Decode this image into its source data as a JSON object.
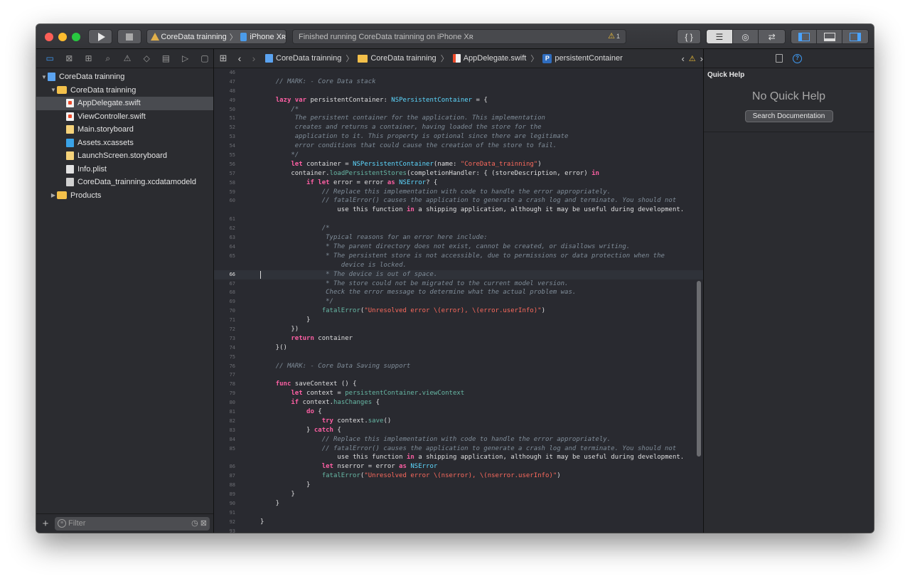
{
  "toolbar": {
    "scheme_app": "CoreData trainning",
    "scheme_device": "iPhone Xʀ",
    "activity_text": "Finished running CoreData trainning on iPhone Xʀ",
    "warning_count": "1",
    "braces_label": "{ }"
  },
  "navigator": {
    "items": [
      {
        "label": "CoreData trainning",
        "icon": "project-icon",
        "depth": 0,
        "disclosure": "open"
      },
      {
        "label": "CoreData trainning",
        "icon": "folder-icon",
        "depth": 1,
        "disclosure": "open"
      },
      {
        "label": "AppDelegate.swift",
        "icon": "swift-file-icon",
        "depth": 2,
        "selected": true
      },
      {
        "label": "ViewController.swift",
        "icon": "swift-file-icon",
        "depth": 2
      },
      {
        "label": "Main.storyboard",
        "icon": "storyboard-icon",
        "depth": 2
      },
      {
        "label": "Assets.xcassets",
        "icon": "assets-icon",
        "depth": 2
      },
      {
        "label": "LaunchScreen.storyboard",
        "icon": "storyboard-icon",
        "depth": 2
      },
      {
        "label": "Info.plist",
        "icon": "plist-icon",
        "depth": 2
      },
      {
        "label": "CoreData_trainning.xcdatamodeld",
        "icon": "datamodel-icon",
        "depth": 2
      },
      {
        "label": "Products",
        "icon": "folder-icon",
        "depth": 1,
        "disclosure": "closed"
      }
    ],
    "filter_placeholder": "Filter"
  },
  "jumpbar": {
    "crumbs": [
      "CoreData trainning",
      "CoreData trainning",
      "AppDelegate.swift",
      "persistentContainer"
    ],
    "prop_badge": "P"
  },
  "editor": {
    "current_line": 66,
    "lines": [
      {
        "n": "46",
        "text": ""
      },
      {
        "n": "47",
        "text": "    // MARK: - Core Data stack"
      },
      {
        "n": "48",
        "text": ""
      },
      {
        "n": "49",
        "text": "    lazy var persistentContainer: NSPersistentContainer = {"
      },
      {
        "n": "50",
        "text": "        /*"
      },
      {
        "n": "51",
        "text": "         The persistent container for the application. This implementation"
      },
      {
        "n": "52",
        "text": "         creates and returns a container, having loaded the store for the"
      },
      {
        "n": "53",
        "text": "         application to it. This property is optional since there are legitimate"
      },
      {
        "n": "54",
        "text": "         error conditions that could cause the creation of the store to fail."
      },
      {
        "n": "55",
        "text": "        */"
      },
      {
        "n": "56",
        "text": "        let container = NSPersistentContainer(name: \"CoreData_trainning\")"
      },
      {
        "n": "57",
        "text": "        container.loadPersistentStores(completionHandler: { (storeDescription, error) in"
      },
      {
        "n": "58",
        "text": "            if let error = error as NSError? {"
      },
      {
        "n": "59",
        "text": "                // Replace this implementation with code to handle the error appropriately."
      },
      {
        "n": "60",
        "text": "                // fatalError() causes the application to generate a crash log and terminate. You should not\n                    use this function in a shipping application, although it may be useful during development."
      },
      {
        "n": "61",
        "text": ""
      },
      {
        "n": "62",
        "text": "                /*"
      },
      {
        "n": "63",
        "text": "                 Typical reasons for an error here include:"
      },
      {
        "n": "64",
        "text": "                 * The parent directory does not exist, cannot be created, or disallows writing."
      },
      {
        "n": "65",
        "text": "                 * The persistent store is not accessible, due to permissions or data protection when the\n                     device is locked."
      },
      {
        "n": "66",
        "text": "                 * The device is out of space."
      },
      {
        "n": "67",
        "text": "                 * The store could not be migrated to the current model version."
      },
      {
        "n": "68",
        "text": "                 Check the error message to determine what the actual problem was."
      },
      {
        "n": "69",
        "text": "                 */"
      },
      {
        "n": "70",
        "text": "                fatalError(\"Unresolved error \\(error), \\(error.userInfo)\")"
      },
      {
        "n": "71",
        "text": "            }"
      },
      {
        "n": "72",
        "text": "        })"
      },
      {
        "n": "73",
        "text": "        return container"
      },
      {
        "n": "74",
        "text": "    }()"
      },
      {
        "n": "75",
        "text": ""
      },
      {
        "n": "76",
        "text": "    // MARK: - Core Data Saving support"
      },
      {
        "n": "77",
        "text": ""
      },
      {
        "n": "78",
        "text": "    func saveContext () {"
      },
      {
        "n": "79",
        "text": "        let context = persistentContainer.viewContext"
      },
      {
        "n": "80",
        "text": "        if context.hasChanges {"
      },
      {
        "n": "81",
        "text": "            do {"
      },
      {
        "n": "82",
        "text": "                try context.save()"
      },
      {
        "n": "83",
        "text": "            } catch {"
      },
      {
        "n": "84",
        "text": "                // Replace this implementation with code to handle the error appropriately."
      },
      {
        "n": "85",
        "text": "                // fatalError() causes the application to generate a crash log and terminate. You should not\n                    use this function in a shipping application, although it may be useful during development."
      },
      {
        "n": "86",
        "text": "                let nserror = error as NSError"
      },
      {
        "n": "87",
        "text": "                fatalError(\"Unresolved error \\(nserror), \\(nserror.userInfo)\")"
      },
      {
        "n": "88",
        "text": "            }"
      },
      {
        "n": "89",
        "text": "        }"
      },
      {
        "n": "90",
        "text": "    }"
      },
      {
        "n": "91",
        "text": ""
      },
      {
        "n": "92",
        "text": "}"
      },
      {
        "n": "93",
        "text": ""
      }
    ]
  },
  "inspector": {
    "title": "Quick Help",
    "empty_text": "No Quick Help",
    "search_button": "Search Documentation"
  },
  "colors": {
    "keyword": "#fc5fa3",
    "comment": "#7f8c98",
    "type": "#5dd8ff",
    "function": "#67b7a4",
    "string": "#fc6a5d",
    "accent": "#3f9cf6"
  }
}
